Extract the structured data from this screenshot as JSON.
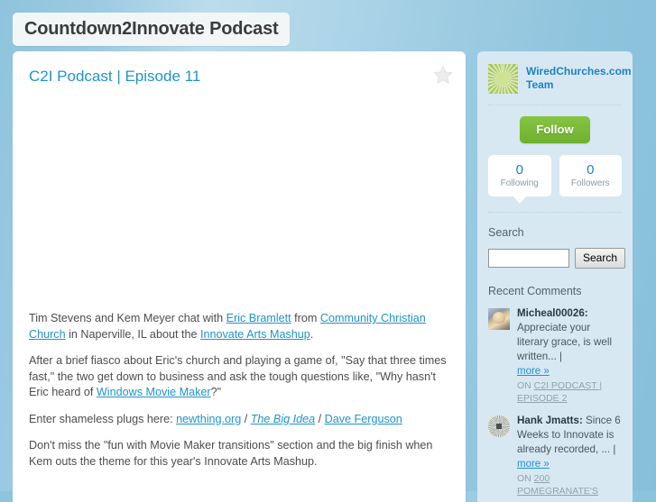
{
  "header": {
    "site_title": "Countdown2Innovate Podcast"
  },
  "post": {
    "title": "C2I Podcast | Episode 11",
    "favorite_icon": "star-icon",
    "paragraphs": [
      {
        "parts": [
          {
            "text": "Tim Stevens and Kem Meyer chat with ",
            "type": "text"
          },
          {
            "text": "Eric Bramlett",
            "type": "link"
          },
          {
            "text": " from ",
            "type": "text"
          },
          {
            "text": "Community Christian Church",
            "type": "link"
          },
          {
            "text": " in Naperville, IL about the ",
            "type": "text"
          },
          {
            "text": "Innovate Arts Mashup",
            "type": "link"
          },
          {
            "text": ".",
            "type": "text"
          }
        ]
      },
      {
        "parts": [
          {
            "text": "After a brief fiasco about Eric's church and playing a game of, \"Say that three times fast,\" the two get down to business and ask the tough questions like, \"Why hasn't Eric heard of ",
            "type": "text"
          },
          {
            "text": "Windows Movie Maker",
            "type": "link"
          },
          {
            "text": "?\"",
            "type": "text"
          }
        ]
      },
      {
        "parts": [
          {
            "text": "Enter shameless plugs here: ",
            "type": "text"
          },
          {
            "text": "newthing.org",
            "type": "link"
          },
          {
            "text": " / ",
            "type": "text"
          },
          {
            "text": "The Big Idea",
            "type": "link-italic"
          },
          {
            "text": " / ",
            "type": "text"
          },
          {
            "text": "Dave Ferguson",
            "type": "link"
          }
        ]
      },
      {
        "parts": [
          {
            "text": "Don't miss the \"fun with Movie Maker transitions\" section and the big finish when Kem outs the theme for this year's Innovate Arts Mashup.",
            "type": "text"
          }
        ]
      }
    ]
  },
  "sidebar": {
    "profile": {
      "name": "WiredChurches.com Team",
      "avatar_icon": "starburst-avatar"
    },
    "follow_label": "Follow",
    "stats": [
      {
        "value": "0",
        "label": "Following"
      },
      {
        "value": "0",
        "label": "Followers"
      }
    ],
    "search": {
      "title": "Search",
      "value": "",
      "placeholder": "",
      "button_label": "Search"
    },
    "comments": {
      "title": "Recent Comments",
      "items": [
        {
          "author": "Micheal00026:",
          "author_inline": false,
          "text": "Appreciate your literary grace, is well written... |",
          "more_label": "more »",
          "on_prefix": "ON",
          "on_link": "C2I PODCAST | EPISODE 2",
          "avatar_icon": "user-photo-avatar"
        },
        {
          "author": "Hank Jmatts:",
          "author_inline": true,
          "text": "Since 6 Weeks to Innovate is already recorded, ... |",
          "more_label": "more »",
          "on_prefix": "ON",
          "on_link": "200 POMEGRANATE'S",
          "avatar_icon": "pattern-avatar"
        }
      ]
    }
  },
  "colors": {
    "page_background": "#9ccbe2",
    "link": "#2293c9",
    "follow_green": "#86c442",
    "sidebar_background": "#d7e8f2",
    "card_background": "#ffffff"
  }
}
